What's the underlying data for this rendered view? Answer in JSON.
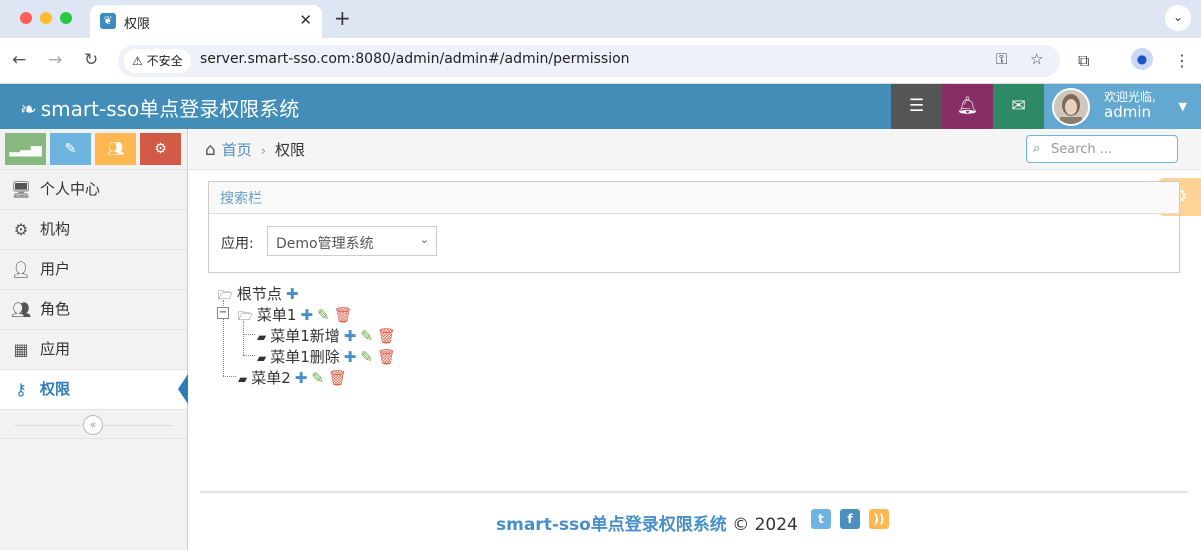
{
  "browser": {
    "tab_title": "权限",
    "secure_label": "不安全",
    "url": "server.smart-sso.com:8080/admin/admin#/admin/permission"
  },
  "header": {
    "brand": "smart-sso单点登录权限系统",
    "welcome": "欢迎光临,",
    "username": "admin"
  },
  "sidebar": {
    "items": [
      {
        "label": "个人中心",
        "icon": "monitor-icon"
      },
      {
        "label": "机构",
        "icon": "cogs-icon"
      },
      {
        "label": "用户",
        "icon": "user-icon"
      },
      {
        "label": "角色",
        "icon": "users-icon"
      },
      {
        "label": "应用",
        "icon": "grid-icon"
      },
      {
        "label": "权限",
        "icon": "key-icon",
        "active": true
      }
    ]
  },
  "breadcrumb": {
    "home": "首页",
    "current": "权限"
  },
  "search": {
    "placeholder": "Search ..."
  },
  "searchbox": {
    "title": "搜索栏",
    "app_label": "应用:",
    "app_selected": "Demo管理系统"
  },
  "tree": {
    "root": "根节点",
    "menu1": "菜单1",
    "menu1_add": "菜单1新增",
    "menu1_del": "菜单1删除",
    "menu2": "菜单2"
  },
  "footer": {
    "brand": "smart-sso单点登录权限系统",
    "copyright": "© 2024"
  },
  "colors": {
    "header": "#438eb9",
    "accent": "#478fca",
    "add": "#478fca",
    "edit": "#69aa46",
    "delete": "#dd5a43"
  }
}
